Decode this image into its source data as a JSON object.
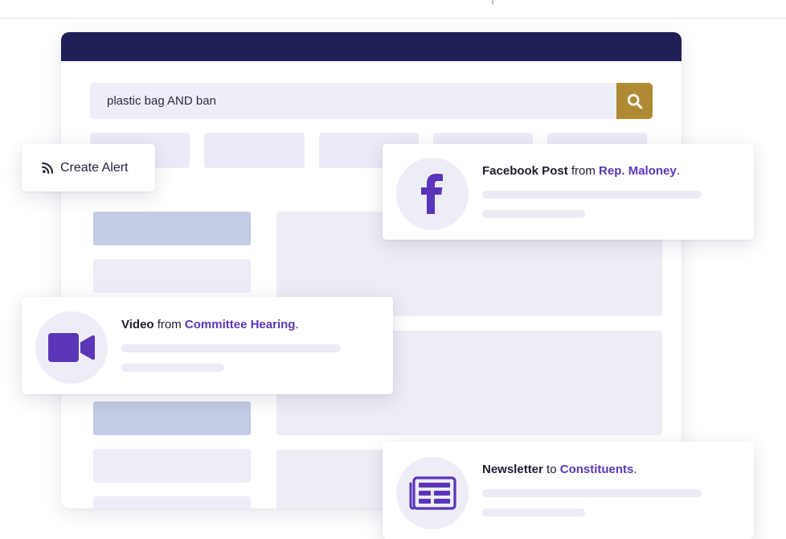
{
  "search": {
    "query": "plastic bag AND ban",
    "button_icon": "search-icon"
  },
  "alert": {
    "label": "Create Alert",
    "icon": "rss-icon"
  },
  "cards": {
    "facebook": {
      "type": "Facebook Post",
      "connector": "from",
      "source": "Rep. Maloney",
      "end": ".",
      "icon": "facebook-icon"
    },
    "video": {
      "type": "Video",
      "connector": "from",
      "source": "Committee Hearing",
      "end": ".",
      "icon": "video-camera-icon"
    },
    "newsletter": {
      "type": "Newsletter",
      "connector": "to",
      "source": "Constituents",
      "end": ".",
      "icon": "newsletter-icon"
    }
  },
  "colors": {
    "titlebar": "#1f1f57",
    "accent_purple": "#5b35b8",
    "search_button": "#b08a32",
    "skeleton": "#ebebf4"
  }
}
